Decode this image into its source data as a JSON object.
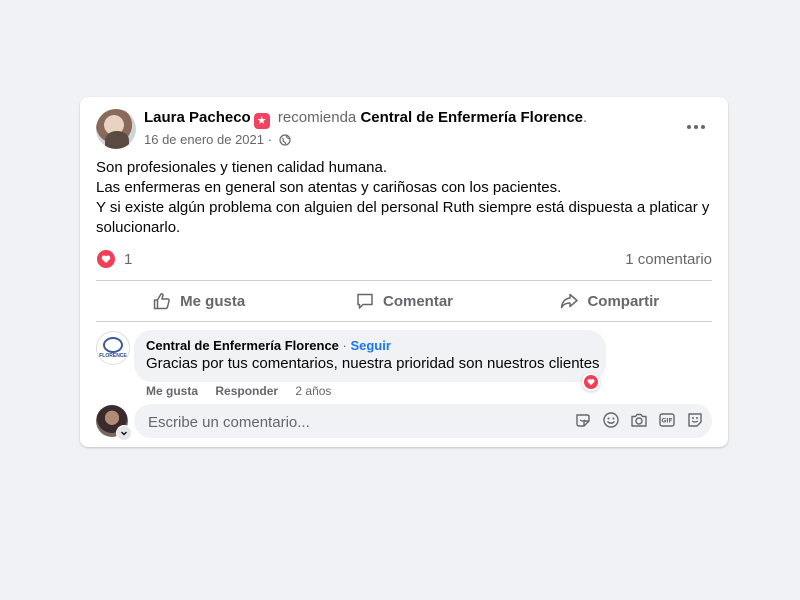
{
  "post": {
    "author": "Laura Pacheco",
    "verb": "recomienda",
    "page": "Central de Enfermería Florence",
    "period": ".",
    "date": "16 de enero de 2021",
    "date_sep": " · ",
    "lines": [
      "Son profesionales y tienen calidad humana.",
      "Las enfermeras en general son atentas y cariñosas con los pacientes.",
      "Y si existe algún problema con alguien del personal Ruth siempre está dispuesta a platicar y solucionarlo."
    ],
    "reaction_count": "1",
    "comment_count": "1 comentario"
  },
  "actions": {
    "like": "Me gusta",
    "comment": "Comentar",
    "share": "Compartir"
  },
  "comment": {
    "author": "Central de Enfermería Florence",
    "sep": " · ",
    "follow": "Seguir",
    "text": "Gracias por tus comentarios, nuestra prioridad son nuestros clientes",
    "like": "Me gusta",
    "reply": "Responder",
    "age": "2 años",
    "avatar_text": "FLORENCE"
  },
  "composer": {
    "placeholder": "Escribe un comentario..."
  },
  "colors": {
    "accent": "#1877f2",
    "love": "#f33e58",
    "secondary_text": "#65676b",
    "background": "#f0f2f5"
  },
  "icons": [
    "more-options-icon",
    "globe-icon",
    "love-reaction-icon",
    "like-icon",
    "comment-icon",
    "share-icon",
    "sticker-icon",
    "emoji-icon",
    "camera-icon",
    "gif-icon",
    "avatar-sticker-icon",
    "chevron-down-icon"
  ]
}
